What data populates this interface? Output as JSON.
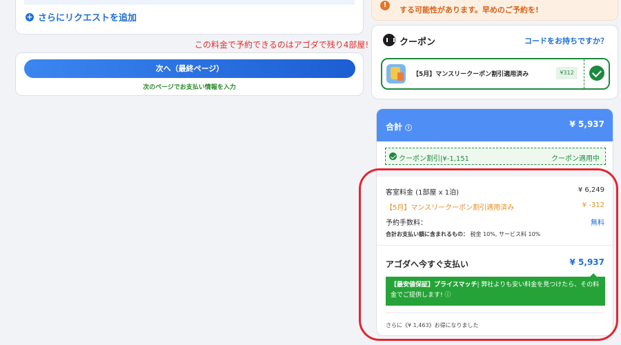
{
  "requests": {
    "add_label": "さらにリクエストを追加"
  },
  "urgency_text": "この料金で予約できるのはアゴダで残り4部屋!",
  "next": {
    "button_label": "次へ（最終ページ）",
    "sub_label": "次のページでお支払い情報を入力"
  },
  "notice": {
    "text": "する可能性があります。早めのご予約を!"
  },
  "coupon": {
    "title": "クーポン",
    "code_link": "コードをお持ちですか？",
    "ticket": {
      "label": "【5月】マンスリークーポン割引適用済み",
      "amount": "¥312"
    }
  },
  "summary": {
    "total_label": "合計",
    "total_amount": "¥ 5,937",
    "coupon_discount": "クーポン割引|¥-1,151",
    "coupon_status": "クーポン適用中",
    "room_label": "客室料金 (1部屋 x 1泊)",
    "room_amount": "¥ 6,249",
    "coupon_label": "【5月】マンスリークーポン割引適用済み",
    "coupon_amount": "¥ -312",
    "fee_label": "予約手数料：",
    "fee_amount": "無料",
    "includes_label": "合計お支払い額に含まれるもの：",
    "includes_value": "税金 10%, サービス料 10%",
    "pay_now_label": "アゴダへ今すぐ支払い",
    "pay_now_amount": "¥ 5,937",
    "guarantee_title": "【最安値保証】プライスマッチ",
    "guarantee_text": "| 弊社よりも安い料金を見つけたら、その料金でご提供します! ⓘ",
    "savings_text": "さらに《¥ 1,463》お得になりました"
  },
  "icons": {
    "info": "info-icon",
    "check": "check-icon",
    "coupon": "coupon-icon",
    "plus": "plus-icon"
  },
  "colors": {
    "accent_blue": "#1f6fd6",
    "header_blue": "#4f8ff5",
    "success_green": "#1c8a3f",
    "warning_red": "#e12d2d",
    "discount_orange": "#e88d1f",
    "highlight_ring": "#e4232f"
  }
}
